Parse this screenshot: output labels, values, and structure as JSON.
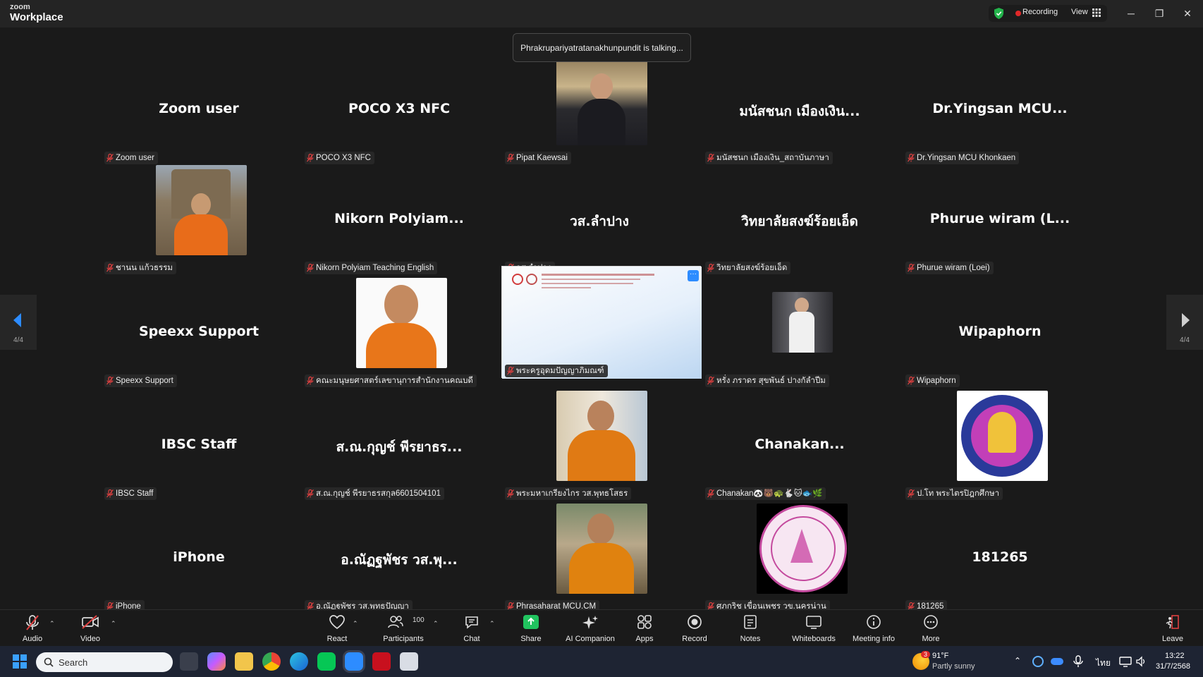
{
  "window": {
    "logo_small": "zoom",
    "logo_big": "Workplace",
    "recording_label": "Recording",
    "view_label": "View",
    "minimize": "─",
    "restore": "❐",
    "close": "✕"
  },
  "meeting": {
    "talking_banner": "Phrakrupariyatratanakhunpundit is talking...",
    "page_left": "4/4",
    "page_right": "4/4"
  },
  "tiles": [
    {
      "big": "Zoom user",
      "label": "Zoom user"
    },
    {
      "big": "POCO X3 NFC",
      "label": "POCO X3 NFC"
    },
    {
      "big": "",
      "label": "Pipat Kaewsai"
    },
    {
      "big": "มนัสชนก เมืองเงิน...",
      "label": "มนัสชนก เมืองเงิน_สถาบันภาษา"
    },
    {
      "big": "Dr.Yingsan  MCU...",
      "label": "Dr.Yingsan MCU Khonkaen"
    },
    {
      "big": "",
      "label": "ชานน แก้วธรรม"
    },
    {
      "big": "Nikorn  Polyiam...",
      "label": "Nikorn Polyiam Teaching English"
    },
    {
      "big": "วส.ลำปาง",
      "label": "วส.ลำปาง"
    },
    {
      "big": "วิทยาลัยสงฆ์ร้อยเอ็ด",
      "label": "วิทยาลัยสงฆ์ร้อยเอ็ด"
    },
    {
      "big": "Phurue wiram  (L...",
      "label": "Phurue wiram (Loei)"
    },
    {
      "big": "Speexx Support",
      "label": "Speexx Support"
    },
    {
      "big": "",
      "label": "คณะมนุษยศาสตร์เลขานุการสำนักงานคณบดี"
    },
    {
      "big": "",
      "label": "พระครูอุดมปัญญาภิมณฑ์"
    },
    {
      "big": "",
      "label": "หรั่ง ภราดร สุขพันธ์ ปางกัลำปีม"
    },
    {
      "big": "Wipaphorn",
      "label": "Wipaphorn"
    },
    {
      "big": "IBSC Staff",
      "label": "IBSC Staff"
    },
    {
      "big": "ส.ณ.กุญช์ พีรยาธร...",
      "label": "ส.ณ.กุญช์ พีรยาธรสกุล6601504101"
    },
    {
      "big": "",
      "label": "พระมหาเกรียงไกร วส.พุทธโสธร"
    },
    {
      "big": "Chanakan...",
      "label": "Chanakan🐼🐻🐢🐇🐱🐟🌿"
    },
    {
      "big": "",
      "label": "ป.โท พระไตรปิฎกศึกษา"
    },
    {
      "big": "iPhone",
      "label": "iPhone"
    },
    {
      "big": "อ.ณัฏฐพัชร วส.พุ...",
      "label": "อ.ณัฏฐพัชร วส.พุทธปัญญา"
    },
    {
      "big": "",
      "label": "Phrasaharat MCU.CM"
    },
    {
      "big": "",
      "label": "ศุภกริช เขื่อนเพชร วข.นครน่าน"
    },
    {
      "big": "181265",
      "label": "181265"
    }
  ],
  "toolbar": {
    "audio": "Audio",
    "video": "Video",
    "react": "React",
    "participants": "Participants",
    "participants_count": "100",
    "chat": "Chat",
    "share": "Share",
    "ai_companion": "AI Companion",
    "apps": "Apps",
    "record": "Record",
    "notes": "Notes",
    "whiteboards": "Whiteboards",
    "meeting_info": "Meeting info",
    "more": "More",
    "leave": "Leave"
  },
  "taskbar": {
    "search_placeholder": "Search",
    "weather_temp": "91°F",
    "weather_desc": "Partly sunny",
    "weather_badge": "3",
    "language": "ไทย",
    "time": "13:22",
    "date": "31/7/2568"
  },
  "colors": {
    "background": "#1a1a1a",
    "accent_blue": "#2d8cff",
    "recording_red": "#e02828",
    "share_green": "#21c35f"
  }
}
